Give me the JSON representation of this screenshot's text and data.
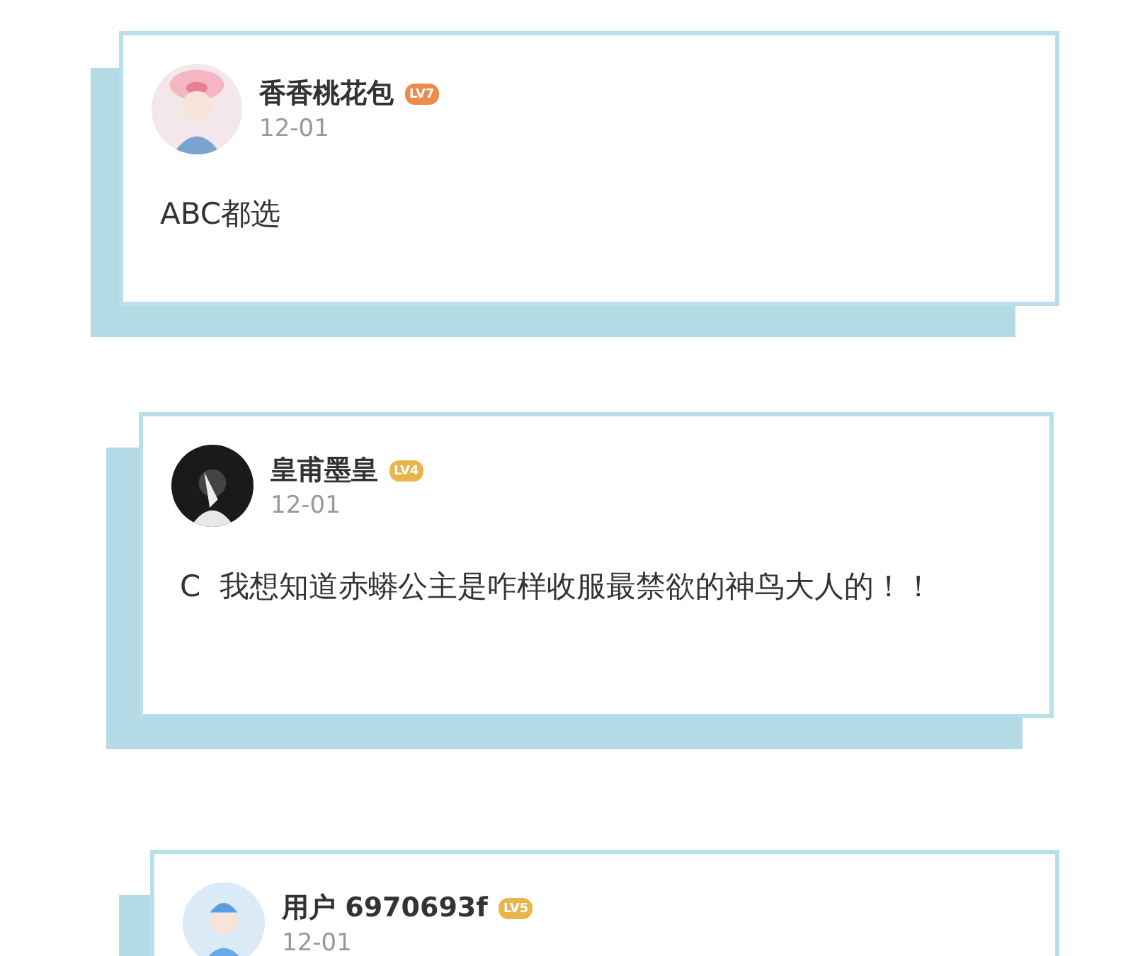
{
  "comments": [
    {
      "user": "香香桃花包",
      "badge": {
        "text": "LV7",
        "color": "#f08a4b"
      },
      "date": "12-01",
      "text": "ABC都选"
    },
    {
      "user": "皇甫墨皇",
      "badge": {
        "text": "LV4",
        "color": "#e8b54a"
      },
      "date": "12-01",
      "text": "C  我想知道赤蟒公主是咋样收服最禁欲的神鸟大人的！！"
    },
    {
      "user": "用户 6970693f",
      "badge": {
        "text": "LV5",
        "color": "#e8b54a"
      },
      "date": "12-01"
    }
  ]
}
